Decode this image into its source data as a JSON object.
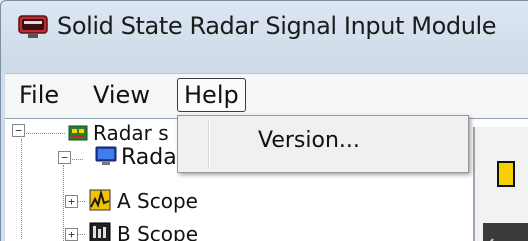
{
  "window": {
    "title": "Solid State Radar Signal Input Module",
    "icon": "app-monitor-icon"
  },
  "menubar": {
    "items": [
      {
        "label": "File"
      },
      {
        "label": "View"
      },
      {
        "label": "Help"
      }
    ]
  },
  "help_menu": {
    "items": [
      {
        "label": "Version..."
      }
    ]
  },
  "tree": {
    "root": {
      "label": "Radar s",
      "icon": "radar-chip-icon",
      "expander": "−"
    },
    "child": {
      "label": "Radar Image",
      "icon": "monitor-icon",
      "expander": "−"
    },
    "grandchildren": [
      {
        "label": "A Scope",
        "icon": "a-scope-icon",
        "expander": "+"
      },
      {
        "label": "B Scope",
        "icon": "b-scope-icon",
        "expander": "+"
      }
    ]
  },
  "right_pane": {
    "heading_glyph": "I"
  },
  "colors": {
    "menu_highlight_border": "#3b3b3b",
    "title_icon": "#b8272d",
    "tree_line": "#8c8c8c"
  }
}
